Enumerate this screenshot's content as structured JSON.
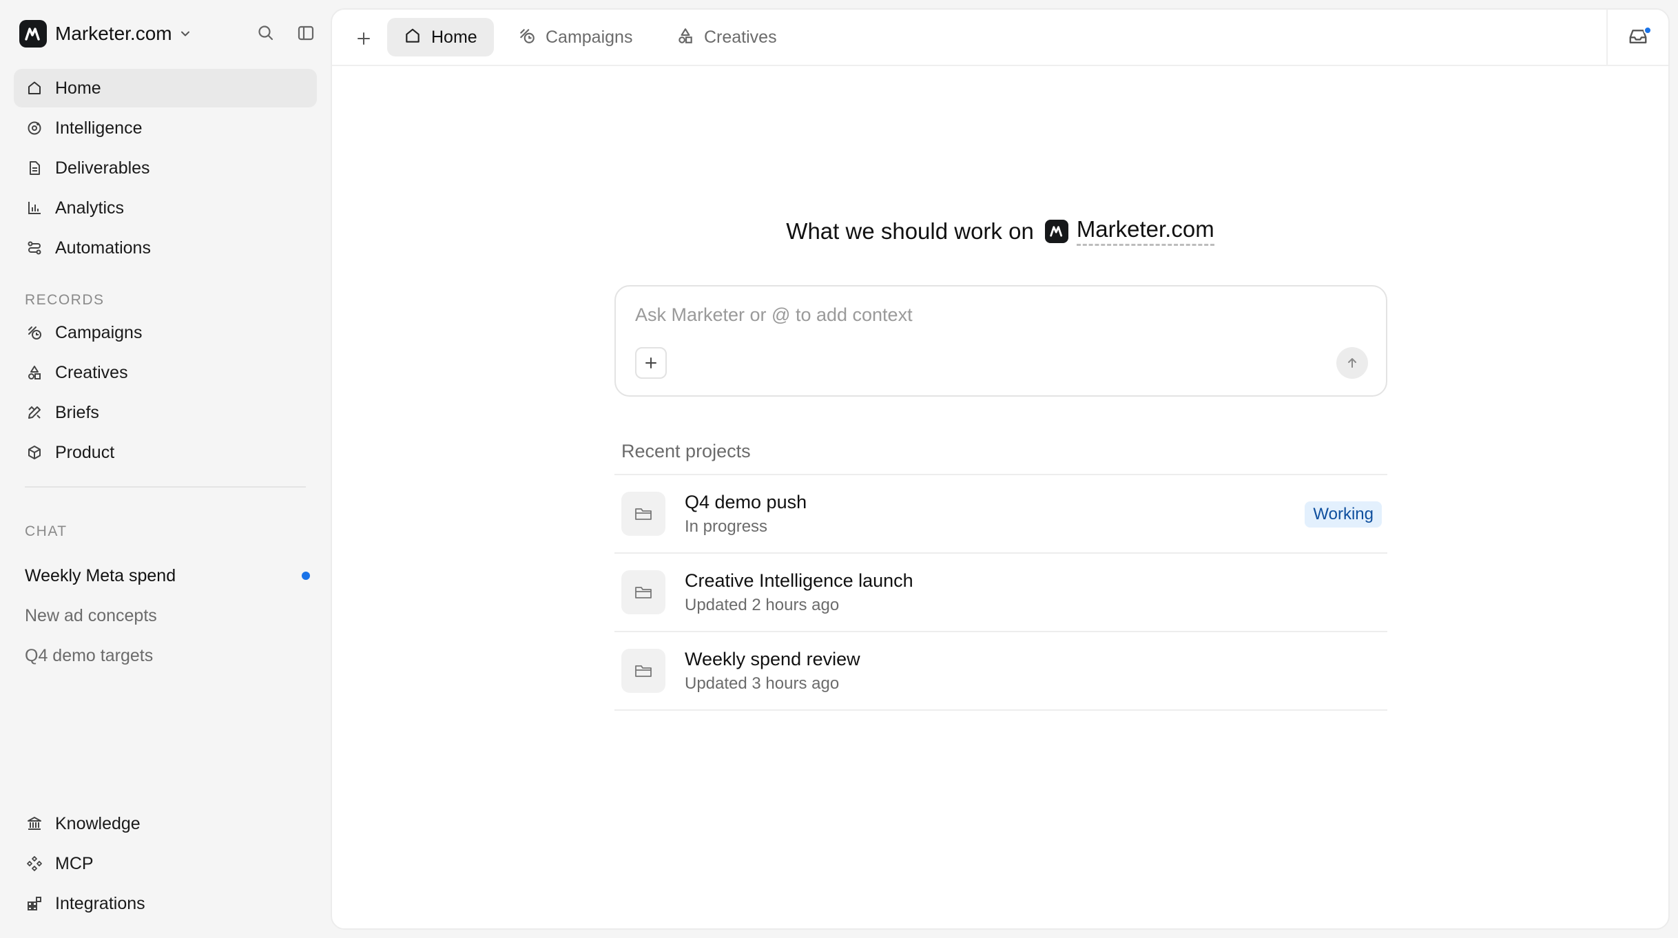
{
  "workspace": {
    "name": "Marketer.com"
  },
  "sidebar": {
    "primary": [
      {
        "label": "Home",
        "icon": "home-icon",
        "active": true
      },
      {
        "label": "Intelligence",
        "icon": "intelligence-icon"
      },
      {
        "label": "Deliverables",
        "icon": "document-icon"
      },
      {
        "label": "Analytics",
        "icon": "bar-chart-icon"
      },
      {
        "label": "Automations",
        "icon": "automations-icon"
      }
    ],
    "records_title": "RECORDS",
    "records": [
      {
        "label": "Campaigns",
        "icon": "campaigns-icon"
      },
      {
        "label": "Creatives",
        "icon": "shapes-icon"
      },
      {
        "label": "Briefs",
        "icon": "pencil-ruler-icon"
      },
      {
        "label": "Product",
        "icon": "package-icon"
      }
    ],
    "chat_title": "CHAT",
    "chats": [
      {
        "label": "Weekly Meta spend",
        "unread": true
      },
      {
        "label": "New ad concepts",
        "unread": false
      },
      {
        "label": "Q4 demo targets",
        "unread": false
      }
    ],
    "bottom": [
      {
        "label": "Knowledge",
        "icon": "library-icon"
      },
      {
        "label": "MCP",
        "icon": "mcp-icon"
      },
      {
        "label": "Integrations",
        "icon": "integrations-icon"
      }
    ]
  },
  "tabs": [
    {
      "label": "Home",
      "icon": "home-icon",
      "active": true
    },
    {
      "label": "Campaigns",
      "icon": "campaigns-icon",
      "active": false
    },
    {
      "label": "Creatives",
      "icon": "shapes-icon",
      "active": false
    }
  ],
  "hero": {
    "question": "What we should work on",
    "workspace": "Marketer.com"
  },
  "composer": {
    "placeholder": "Ask Marketer or @ to add context"
  },
  "recent": {
    "title": "Recent projects",
    "projects": [
      {
        "name": "Q4 demo push",
        "status": "In progress",
        "badge": "Working"
      },
      {
        "name": "Creative Intelligence launch",
        "status": "Updated 2 hours ago"
      },
      {
        "name": "Weekly spend review",
        "status": "Updated 3 hours ago"
      }
    ]
  },
  "colors": {
    "accent": "#1a73e8",
    "badge_bg": "#e3f0fd",
    "badge_text": "#0f4f9e",
    "active_bg": "#e9e9e9"
  }
}
